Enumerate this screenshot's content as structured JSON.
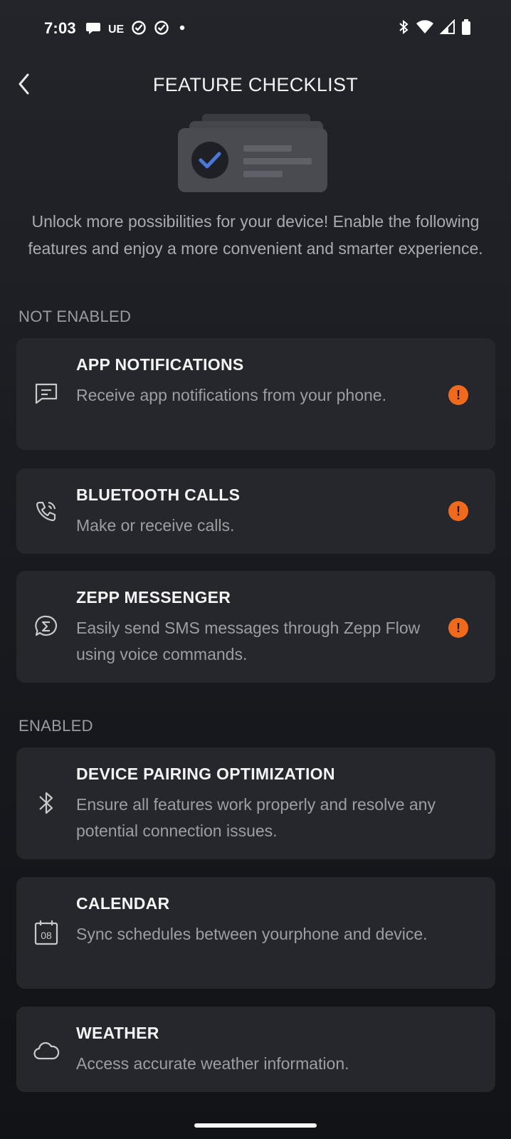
{
  "status_bar": {
    "time": "7:03",
    "left_text": "UE",
    "icons_left": [
      "chat-bubble-icon",
      "check-circle-icon",
      "check-circle-icon",
      "dot-icon"
    ],
    "icons_right": [
      "bluetooth-icon",
      "wifi-icon",
      "signal-icon",
      "battery-icon"
    ]
  },
  "header": {
    "title": "FEATURE CHECKLIST",
    "back_icon": "chevron-left-icon"
  },
  "hero": {
    "icon": "checklist-illustration",
    "accent": "#4a78d8"
  },
  "intro_text": "Unlock more possibilities for your device! Enable the following features and enjoy a more convenient and smarter experience.",
  "sections": {
    "not_enabled": {
      "label": "NOT ENABLED",
      "items": [
        {
          "title": "APP NOTIFICATIONS",
          "description": "Receive app notifications from your phone.",
          "icon": "message-square-icon",
          "status": "warning"
        },
        {
          "title": "BLUETOOTH CALLS",
          "description": "Make or receive calls.",
          "icon": "phone-call-icon",
          "status": "warning"
        },
        {
          "title": "ZEPP MESSENGER",
          "description": "Easily send SMS messages through Zepp Flow using voice commands.",
          "icon": "sigma-chat-icon",
          "status": "warning"
        }
      ]
    },
    "enabled": {
      "label": "ENABLED",
      "items": [
        {
          "title": "DEVICE PAIRING OPTIMIZATION",
          "description": "Ensure all features work properly and resolve any potential connection issues.",
          "icon": "bluetooth-icon"
        },
        {
          "title": "CALENDAR",
          "description": "Sync schedules between yourphone and device.",
          "icon": "calendar-icon",
          "icon_text": "08"
        },
        {
          "title": "WEATHER",
          "description": "Access accurate weather information.",
          "icon": "cloud-icon"
        }
      ]
    }
  },
  "badge_symbol": "!",
  "colors": {
    "background": "#1a1c21",
    "card": "#26272c",
    "warning": "#f06a1e",
    "title_text": "#f4f4f4",
    "secondary_text": "#9c9ea3"
  }
}
